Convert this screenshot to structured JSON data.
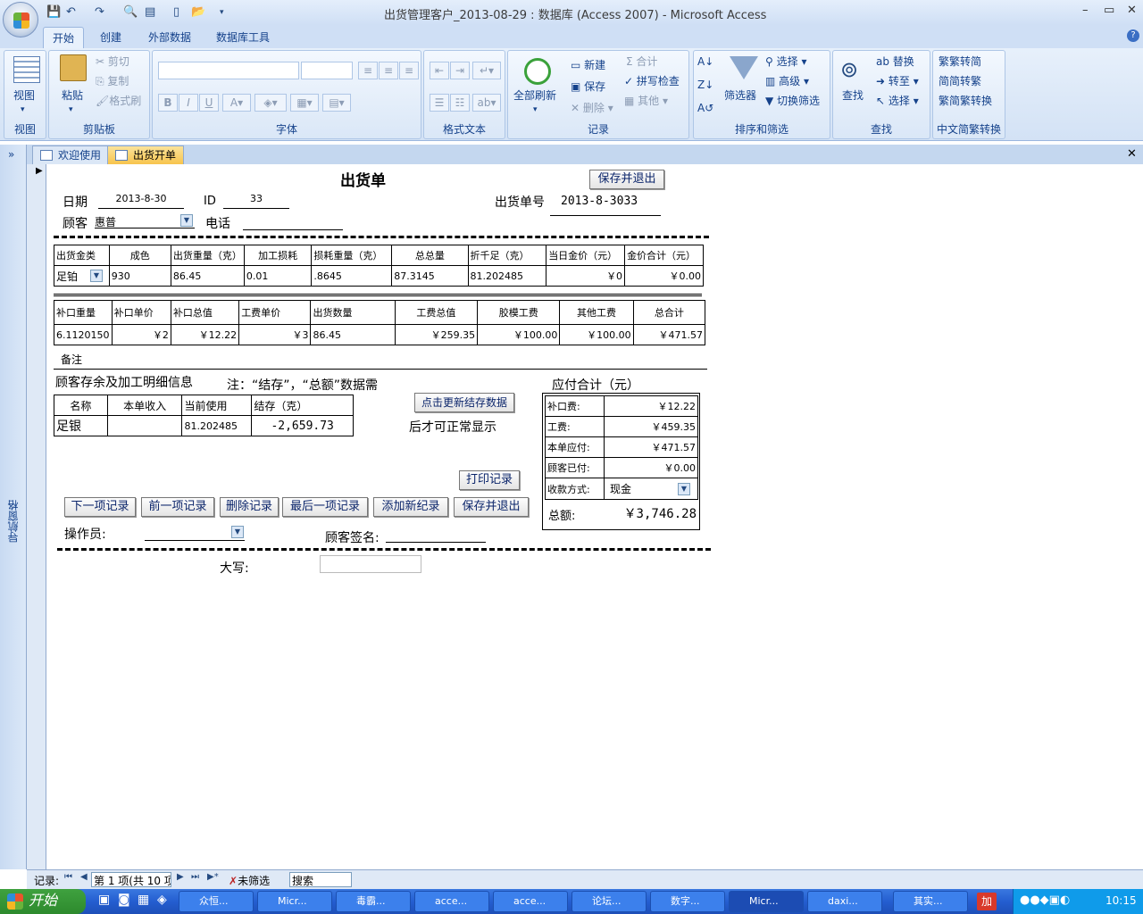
{
  "window": {
    "title": "出货管理客户_2013-08-29 : 数据库 (Access 2007) - Microsoft Access",
    "min": "–",
    "max": "▭",
    "close": "✕"
  },
  "ribbon_tabs": [
    "开始",
    "创建",
    "外部数据",
    "数据库工具"
  ],
  "help": "?",
  "groups": {
    "view": {
      "label": "视图",
      "btn": "视图"
    },
    "clipboard": {
      "label": "剪贴板",
      "paste": "粘贴",
      "cut": "剪切",
      "copy": "复制",
      "format_painter": "格式刷"
    },
    "font": {
      "label": "字体",
      "bold": "B",
      "italic": "I",
      "underline": "U"
    },
    "rich_text": {
      "label": "格式文本"
    },
    "records": {
      "label": "记录",
      "refresh": "全部刷新",
      "new": "新建",
      "save": "保存",
      "delete": "删除",
      "totals": "合计",
      "spelling": "拼写检查",
      "more": "其他"
    },
    "sort": {
      "label": "排序和筛选",
      "filter": "筛选器",
      "selection": "选择",
      "advanced": "高级",
      "toggle": "切换筛选"
    },
    "find": {
      "label": "查找",
      "find": "查找",
      "replace": "替换",
      "goto": "转至",
      "select": "选择"
    },
    "chinese": {
      "label": "中文简繁转换",
      "t2s": "繁转简",
      "s2t": "简转繁",
      "convert": "简繁转换"
    }
  },
  "doc_tabs": [
    "欢迎使用",
    "出货开单"
  ],
  "nav_pane": "导航窗格",
  "form": {
    "title": "出货单",
    "save_exit_top": "保存并退出",
    "date_label": "日期",
    "date": "2013-8-30",
    "id_label": "ID",
    "id": "33",
    "order_no_label": "出货单号",
    "order_no": "2013-8-3033",
    "customer_label": "顾客",
    "customer": "惠普",
    "phone_label": "电话",
    "phone": "",
    "table1": {
      "headers": [
        "出货金类",
        "成色",
        "出货重量（克）",
        "加工损耗",
        "损耗重量（克）",
        "总总量",
        "折千足（克）",
        "当日金价（元）",
        "金价合计（元）"
      ],
      "row": [
        "足铂",
        "930",
        "86.45",
        "0.01",
        ".8645",
        "87.3145",
        "81.202485",
        "￥0",
        "￥0.00"
      ]
    },
    "table2": {
      "headers": [
        "补口重量",
        "补口单价",
        "补口总值",
        "工费单价",
        "出货数量",
        "工费总值",
        "胶模工费",
        "其他工费",
        "总合计"
      ],
      "row": [
        "6.1120150",
        "￥2",
        "￥12.22",
        "￥3",
        "86.45",
        "￥259.35",
        "￥100.00",
        "￥100.00",
        "￥471.57"
      ]
    },
    "remark_label": "备注",
    "balance_title": "顾客存余及加工明细信息",
    "note1": "注：“结存”，“总额”数据需",
    "note2": "后才可正常显示",
    "update_btn": "点击更新结存数据",
    "table3": {
      "headers": [
        "名称",
        "本单收入",
        "当前使用",
        "结存（克）"
      ],
      "row": [
        "足银",
        "",
        "81.202485",
        "-2,659.73"
      ]
    },
    "payable_title": "应付合计（元）",
    "pay": {
      "patch_label": "补口费:",
      "patch": "￥12.22",
      "labor_label": "工费:",
      "labor": "￥459.35",
      "due_label": "本单应付:",
      "due": "￥471.57",
      "paid_label": "顾客已付:",
      "paid": "￥0.00",
      "method_label": "收款方式:",
      "method": "现金",
      "total_label": "总额:",
      "total": "￥3,746.28"
    },
    "print_btn": "打印记录",
    "buttons": [
      "下一项记录",
      "前一项记录",
      "删除记录",
      "最后一项记录",
      "添加新纪录",
      "保存并退出"
    ],
    "operator_label": "操作员:",
    "sign_label": "顾客签名:",
    "capital_label": "大写:"
  },
  "record_nav": {
    "label": "记录:",
    "position": "第 1 项(共 10 项",
    "filter": "未筛选",
    "search": "搜索"
  },
  "taskbar": {
    "start": "开始",
    "tasks": [
      "众恒...",
      "Micr...",
      "毒霸...",
      "acce...",
      "acce...",
      "论坛...",
      "数字...",
      "Micr...",
      "daxi...",
      "其实..."
    ],
    "ime": "加",
    "clock": "10:15"
  }
}
